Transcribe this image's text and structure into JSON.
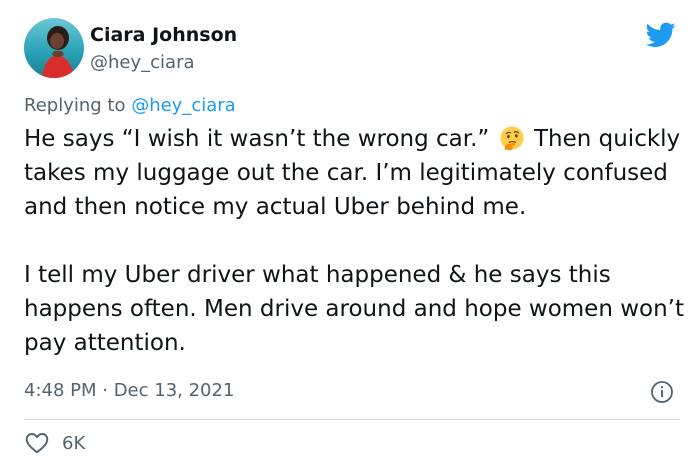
{
  "author": {
    "name": "Ciara Johnson",
    "handle": "@hey_ciara"
  },
  "reply": {
    "prefix": "Replying to ",
    "mention": "@hey_ciara"
  },
  "tweet": {
    "paragraph1_before_emoji": "He says “I wish it wasn’t the wrong car.”",
    "emoji_name": "thinking-face-emoji",
    "paragraph1_after_emoji": "Then quickly takes my luggage out the car. I’m legitimately confused and then notice my actual Uber behind me.",
    "paragraph2": "I tell my Uber driver what happened & he says this happens often. Men drive around and hope women won’t pay attention."
  },
  "meta": {
    "timestamp": "4:48 PM · Dec 13, 2021"
  },
  "actions": {
    "like_count": "6K"
  },
  "icons": {
    "brand": "twitter-bird-icon",
    "info": "info-icon",
    "like": "heart-icon"
  },
  "colors": {
    "brand_blue": "#1d9bf0",
    "secondary_text": "#536471",
    "primary_text": "#0f1419",
    "divider": "#cfd9de"
  }
}
